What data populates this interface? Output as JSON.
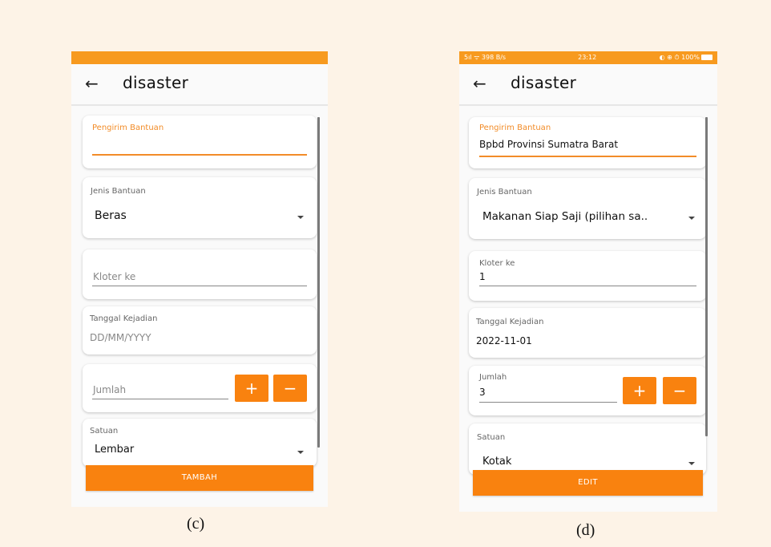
{
  "screens": {
    "c": {
      "app_title": "disaster",
      "fields": {
        "pengirim_label": "Pengirim Bantuan",
        "jenis_label": "Jenis Bantuan",
        "jenis_value": "Beras",
        "kloter_placeholder": "Kloter ke",
        "tanggal_label": "Tanggal Kejadian",
        "tanggal_placeholder": "DD/MM/YYYY",
        "jumlah_placeholder": "Jumlah",
        "satuan_label": "Satuan",
        "satuan_value": "Lembar"
      },
      "plus": "+",
      "minus": "−",
      "submit_label": "TAMBAH",
      "caption": "(c)"
    },
    "d": {
      "status_bar": {
        "left": "5ıl ᯤ 398 B/s",
        "time": "23:12",
        "right": "◐ ⊕ ⏱ 100%"
      },
      "app_title": "disaster",
      "fields": {
        "pengirim_label": "Pengirim Bantuan",
        "pengirim_value": "Bpbd Provinsi Sumatra Barat",
        "jenis_label": "Jenis Bantuan",
        "jenis_value": "Makanan Siap Saji (pilihan sa..",
        "kloter_label": "Kloter ke",
        "kloter_value": "1",
        "tanggal_label": "Tanggal Kejadian",
        "tanggal_value": "2022-11-01",
        "jumlah_label": "Jumlah",
        "jumlah_value": "3",
        "satuan_label": "Satuan",
        "satuan_value": "Kotak"
      },
      "plus": "+",
      "minus": "−",
      "submit_label": "EDIT",
      "caption": "(d)"
    }
  },
  "colors": {
    "accent": "#f9820f",
    "status_bar": "#f79a1f",
    "page_bg": "#fdf3e7"
  }
}
